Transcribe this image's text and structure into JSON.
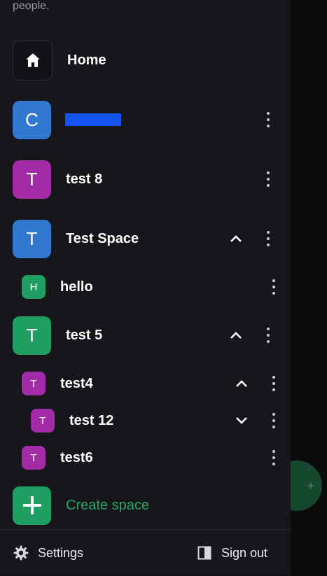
{
  "header_text": "people.",
  "colors": {
    "blue": "#3178d0",
    "purple": "#a32ba7",
    "green": "#1f9e62",
    "create_label": "#28a86b"
  },
  "home": {
    "label": "Home",
    "icon": "home-icon"
  },
  "spaces": [
    {
      "initial": "C",
      "label": "",
      "redacted": true,
      "color": "blue"
    },
    {
      "initial": "T",
      "label": "test 8",
      "color": "purple"
    },
    {
      "initial": "T",
      "label": "Test Space",
      "color": "blue",
      "expanded": true
    },
    {
      "initial": "H",
      "label": "hello",
      "color": "green",
      "child_of": "Test Space"
    },
    {
      "initial": "T",
      "label": "test 5",
      "color": "green",
      "expanded": true
    },
    {
      "initial": "T",
      "label": "test4",
      "color": "purple",
      "child_of": "test 5",
      "expanded": true
    },
    {
      "initial": "T",
      "label": "test 12",
      "color": "purple",
      "child_of": "test4",
      "expanded": false
    },
    {
      "initial": "T",
      "label": "test6",
      "color": "purple",
      "child_of": "test 5"
    }
  ],
  "create_space": {
    "label": "Create space",
    "icon": "plus-icon"
  },
  "footer": {
    "settings": {
      "label": "Settings",
      "icon": "gear-icon"
    },
    "sign_out": {
      "label": "Sign out",
      "icon": "sign-out-icon"
    }
  },
  "fab": {
    "icon": "plus-icon"
  }
}
